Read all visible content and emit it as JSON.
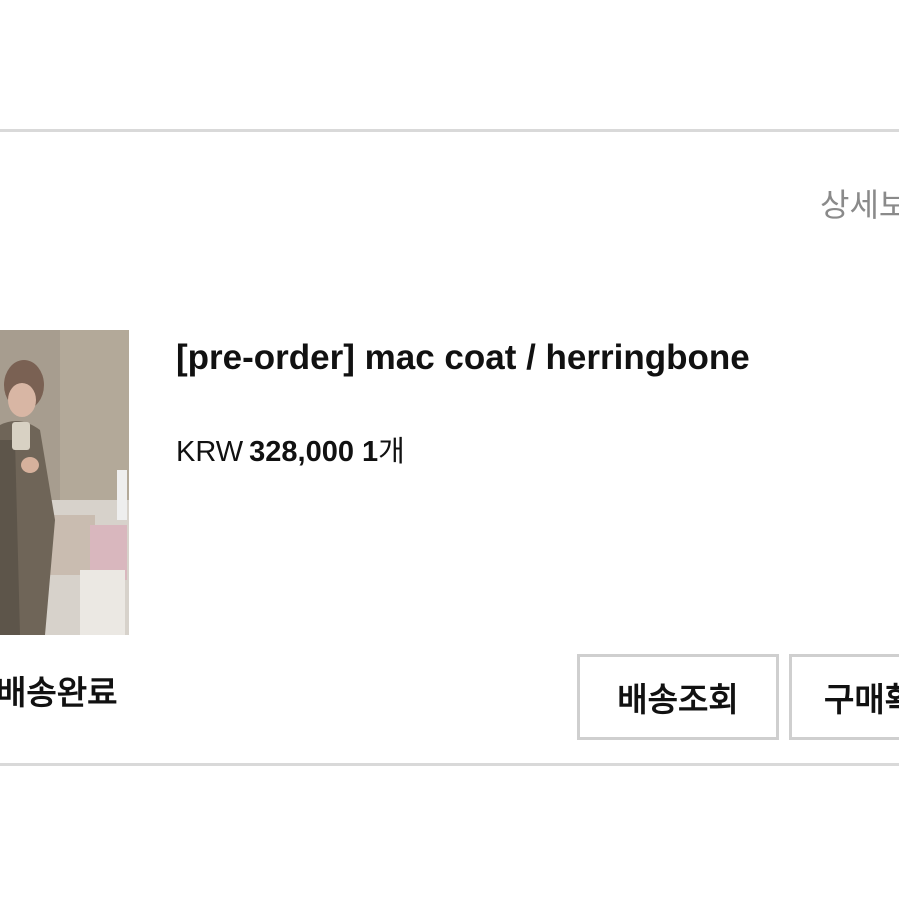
{
  "header": {
    "detail_link_label": "상세보기"
  },
  "order": {
    "product_title": "[pre-order] mac coat / herringbone",
    "currency": "KRW",
    "price": "328,000",
    "quantity": "1",
    "quantity_unit": "개",
    "status": "배송완료"
  },
  "actions": {
    "track_shipping_label": "배송조회",
    "purchase_confirm_label": "구매확정"
  },
  "colors": {
    "divider": "#d9d9d9",
    "button_border": "#cfcfcf",
    "muted_text": "#8a8a8a"
  },
  "icons": {
    "thumbnail": "product-photo"
  }
}
